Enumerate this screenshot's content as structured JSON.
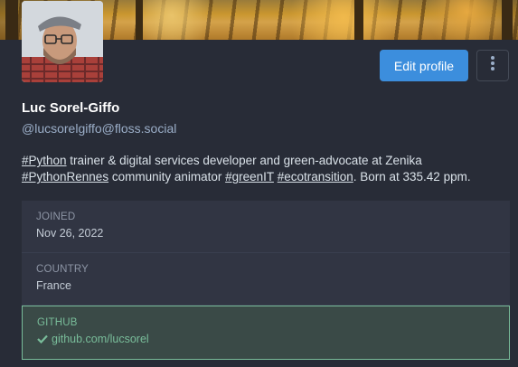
{
  "profile": {
    "display_name": "Luc Sorel-Giffo",
    "handle": "@lucsorelgiffo@floss.social",
    "edit_label": "Edit profile",
    "more_icon": "kebab-vertical-icon",
    "bio": {
      "tag_python": "#Python",
      "text_1": " trainer & digital services developer and green-advocate at Zenika",
      "tag_pythonrennes": "#PythonRennes",
      "text_2": " community animator ",
      "tag_greenit": "#greenIT",
      "text_3": " ",
      "tag_ecotransition": "#ecotransition",
      "text_4": ". Born at 335.42 ppm."
    }
  },
  "fields": [
    {
      "label": "JOINED",
      "value": "Nov 26, 2022"
    },
    {
      "label": "COUNTRY",
      "value": "France"
    },
    {
      "label": "GITHUB",
      "value": "github.com/lucsorel",
      "verified_icon": "check-icon"
    }
  ],
  "colors": {
    "accent": "#3c8edd",
    "verified": "#79bd9a",
    "background": "#282c37"
  }
}
